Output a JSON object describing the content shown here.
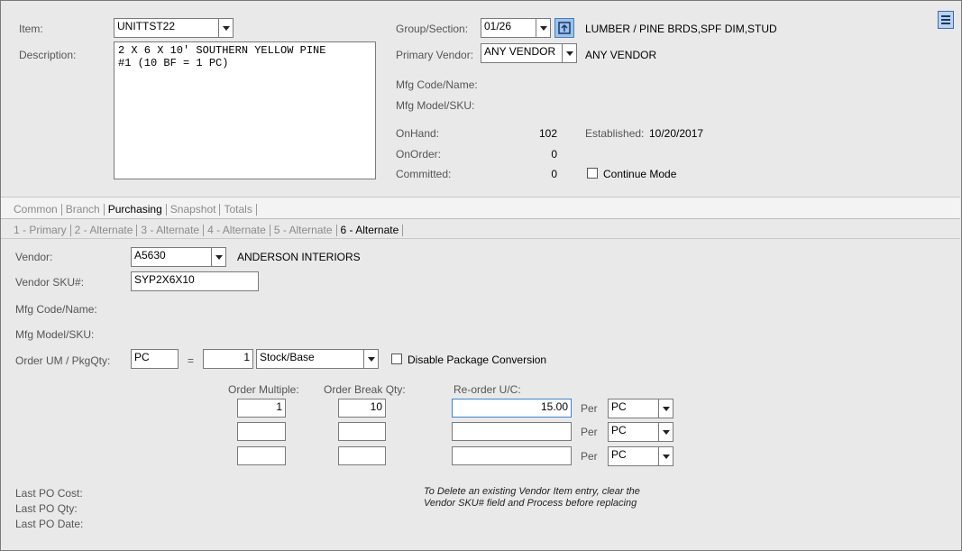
{
  "header": {
    "item_label": "Item:",
    "item_value": "UNITTST22",
    "description_label": "Description:",
    "description_value": "2 X 6 X 10' SOUTHERN YELLOW PINE\n#1 (10 BF = 1 PC)",
    "group_label": "Group/Section:",
    "group_value": "01/26",
    "group_desc": "LUMBER / PINE BRDS,SPF DIM,STUD",
    "primary_vendor_label": "Primary Vendor:",
    "primary_vendor_value": "ANY VENDOR",
    "primary_vendor_name": "ANY VENDOR",
    "mfg_code_label": "Mfg Code/Name:",
    "mfg_model_label": "Mfg Model/SKU:",
    "onhand_label": "OnHand:",
    "onhand_value": "102",
    "onorder_label": "OnOrder:",
    "onorder_value": "0",
    "committed_label": "Committed:",
    "committed_value": "0",
    "established_label": "Established:",
    "established_value": "10/20/2017",
    "continue_mode_label": "Continue Mode"
  },
  "main_tabs": [
    {
      "label": "Common",
      "active": false
    },
    {
      "label": "Branch",
      "active": false
    },
    {
      "label": "Purchasing",
      "active": true
    },
    {
      "label": "Snapshot",
      "active": false
    },
    {
      "label": "Totals",
      "active": false
    }
  ],
  "vendor_tabs": [
    {
      "label": "1 - Primary",
      "active": false
    },
    {
      "label": "2 - Alternate",
      "active": false
    },
    {
      "label": "3 - Alternate",
      "active": false
    },
    {
      "label": "4 - Alternate",
      "active": false
    },
    {
      "label": "5 - Alternate",
      "active": false
    },
    {
      "label": "6 - Alternate",
      "active": true
    }
  ],
  "vendor": {
    "vendor_label": "Vendor:",
    "vendor_value": "A5630",
    "vendor_name": "ANDERSON INTERIORS",
    "sku_label": "Vendor SKU#:",
    "sku_value": "SYP2X6X10",
    "mfg_code_label": "Mfg Code/Name:",
    "mfg_model_label": "Mfg Model/SKU:",
    "order_um_label": "Order UM / PkgQty:",
    "order_um_value": "PC",
    "equals": "=",
    "pkg_qty_value": "1",
    "pkg_type_value": "Stock/Base",
    "disable_conversion_label": "Disable Package Conversion"
  },
  "order_grid": {
    "col_multiple": "Order Multiple:",
    "col_break": "Order Break Qty:",
    "col_reorder": "Re-order U/C:",
    "per_label": "Per",
    "rows": [
      {
        "multiple": "1",
        "break_qty": "10",
        "reorder": "15.00",
        "per": "PC"
      },
      {
        "multiple": "",
        "break_qty": "",
        "reorder": "",
        "per": "PC"
      },
      {
        "multiple": "",
        "break_qty": "",
        "reorder": "",
        "per": "PC"
      }
    ]
  },
  "footer": {
    "last_po_cost": "Last PO Cost:",
    "last_po_qty": "Last PO  Qty:",
    "last_po_date": "Last PO Date:",
    "note": "To Delete an existing Vendor Item entry, clear the Vendor SKU# field and Process before replacing"
  },
  "colors": {
    "accent": "#4a90d9",
    "background": "#e9e9e9"
  },
  "icons": {
    "menu": "hamburger-menu-icon",
    "lookup": "lookup-icon"
  }
}
